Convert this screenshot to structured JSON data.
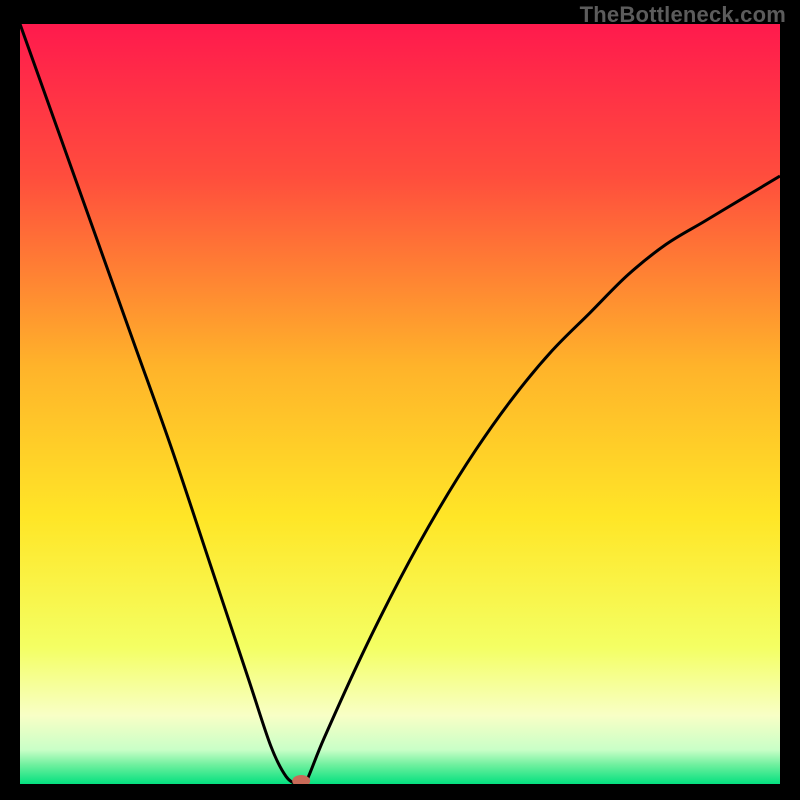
{
  "watermark": "TheBottleneck.com",
  "chart_data": {
    "type": "line",
    "title": "",
    "xlabel": "",
    "ylabel": "",
    "xlim": [
      0,
      100
    ],
    "ylim": [
      0,
      100
    ],
    "grid": false,
    "background_gradient_stops": [
      {
        "offset": 0.0,
        "color": "#ff1a4d"
      },
      {
        "offset": 0.2,
        "color": "#ff4d3d"
      },
      {
        "offset": 0.45,
        "color": "#ffb32a"
      },
      {
        "offset": 0.65,
        "color": "#ffe627"
      },
      {
        "offset": 0.82,
        "color": "#f4ff63"
      },
      {
        "offset": 0.91,
        "color": "#f8ffc6"
      },
      {
        "offset": 0.955,
        "color": "#c9ffc7"
      },
      {
        "offset": 0.975,
        "color": "#6ef09e"
      },
      {
        "offset": 1.0,
        "color": "#04e07f"
      }
    ],
    "series": [
      {
        "name": "curve",
        "color": "#000000",
        "stroke_width": 3,
        "x": [
          0,
          5,
          10,
          15,
          20,
          25,
          30,
          33,
          35,
          36.5,
          37.5,
          40,
          45,
          50,
          55,
          60,
          65,
          70,
          75,
          80,
          85,
          90,
          95,
          100
        ],
        "y": [
          100,
          86,
          72,
          58,
          44,
          29,
          14,
          5,
          1,
          0,
          0,
          6,
          17,
          27,
          36,
          44,
          51,
          57,
          62,
          67,
          71,
          74,
          77,
          80
        ]
      }
    ],
    "marker": {
      "name": "minimum-marker",
      "x": 37,
      "y": 0,
      "rx": 9,
      "ry": 6,
      "fill": "#c96a58"
    }
  }
}
